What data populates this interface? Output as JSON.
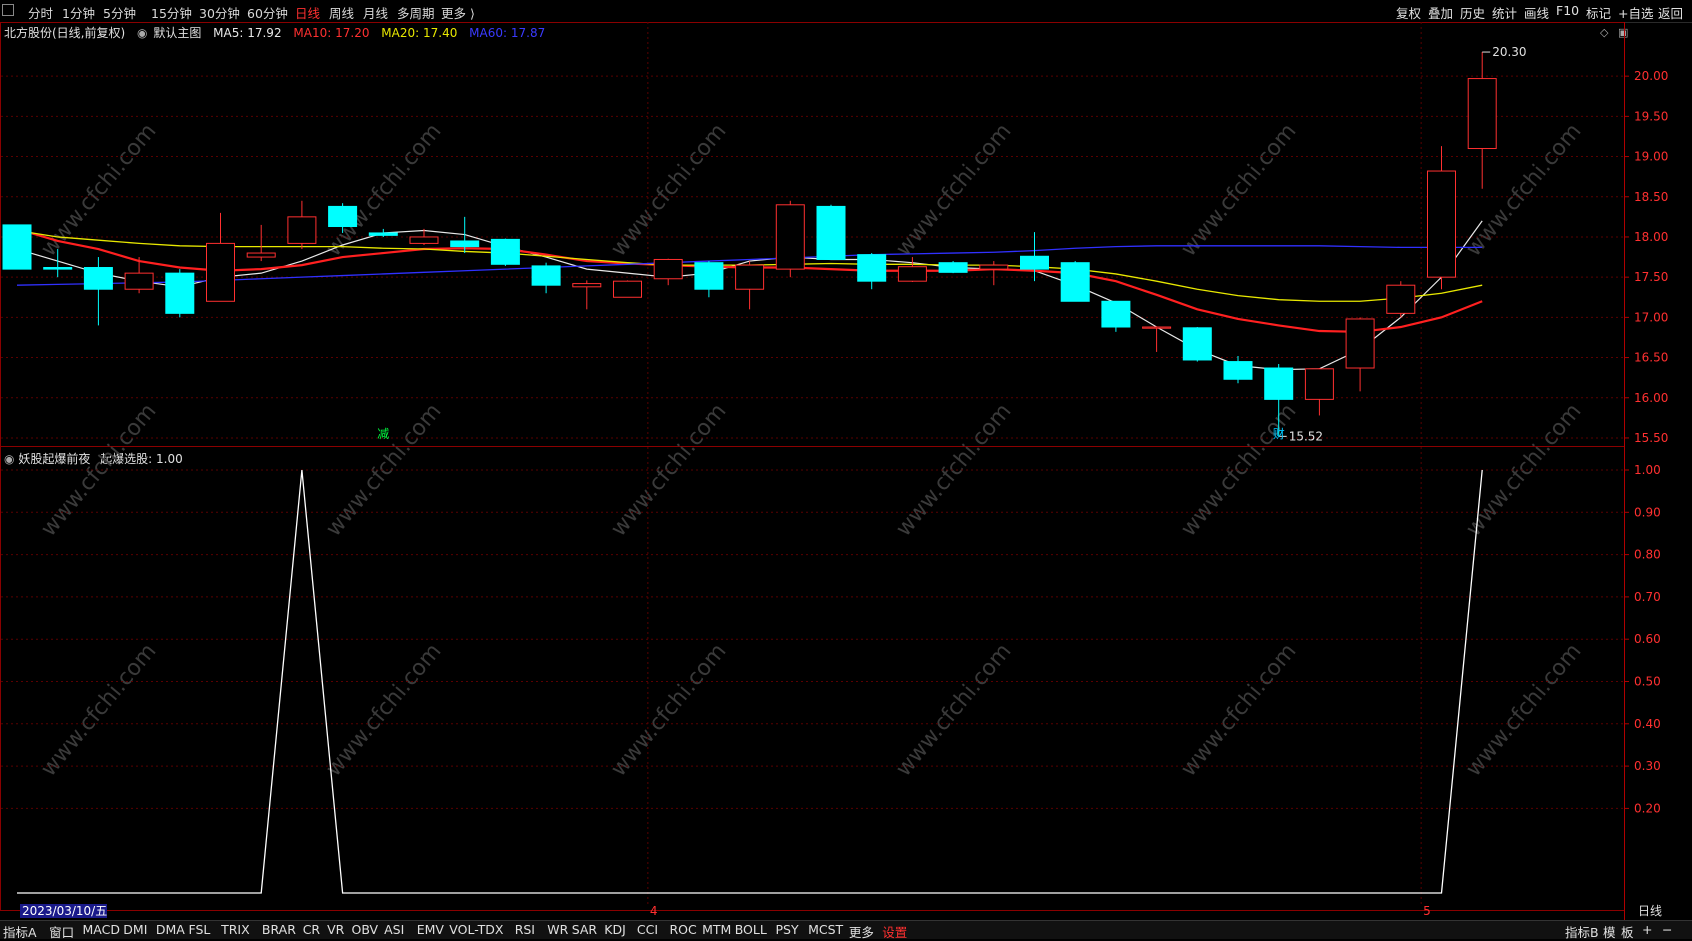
{
  "toolbar": {
    "periods": [
      "分时",
      "1分钟",
      "5分钟",
      "15分钟",
      "30分钟",
      "60分钟",
      "日线",
      "周线",
      "月线",
      "多周期",
      "更多 ⟩"
    ],
    "active_period": "日线",
    "right_items": [
      "复权",
      "叠加",
      "历史",
      "统计",
      "画线",
      "F10",
      "标记",
      "+自选",
      "返回"
    ]
  },
  "legend": {
    "stock": "北方股份(日线,前复权)",
    "template": "默认主图",
    "ma5": "MA5: 17.92",
    "ma10": "MA10: 17.20",
    "ma20": "MA20: 17.40",
    "ma60": "MA60: 17.87"
  },
  "colors": {
    "up": "#ff3030",
    "down": "#00ffff",
    "ma5": "#e8e8e8",
    "ma10": "#ff2020",
    "ma20": "#e8e800",
    "ma60": "#3030ff",
    "grid": "#5a0000",
    "indicator_line": "#ffffff"
  },
  "sub_legend": {
    "title": "妖股起爆前夜",
    "value": "起爆选股: 1.00"
  },
  "chart_data": [
    {
      "type": "candlestick",
      "title": "北方股份(日线,前复权)",
      "ylim": [
        15.4,
        20.4
      ],
      "y_ticks": [
        "20.00",
        "19.50",
        "19.00",
        "18.50",
        "18.00",
        "17.50",
        "17.00",
        "16.50",
        "16.00",
        "15.50"
      ],
      "y_tick_values": [
        20.0,
        19.5,
        19.0,
        18.5,
        18.0,
        17.5,
        17.0,
        16.5,
        16.0,
        15.5
      ],
      "candles": [
        {
          "o": 18.15,
          "h": 18.15,
          "l": 17.6,
          "c": 17.6
        },
        {
          "o": 17.62,
          "h": 17.85,
          "l": 17.5,
          "c": 17.6
        },
        {
          "o": 17.62,
          "h": 17.75,
          "l": 16.9,
          "c": 17.35
        },
        {
          "o": 17.35,
          "h": 17.75,
          "l": 17.3,
          "c": 17.55
        },
        {
          "o": 17.55,
          "h": 17.6,
          "l": 17.0,
          "c": 17.05
        },
        {
          "o": 17.2,
          "h": 18.3,
          "l": 17.2,
          "c": 17.92
        },
        {
          "o": 17.75,
          "h": 18.15,
          "l": 17.7,
          "c": 17.8
        },
        {
          "o": 17.92,
          "h": 18.45,
          "l": 17.85,
          "c": 18.25
        },
        {
          "o": 18.38,
          "h": 18.42,
          "l": 18.05,
          "c": 18.13
        },
        {
          "o": 18.05,
          "h": 18.1,
          "l": 18.0,
          "c": 18.02
        },
        {
          "o": 17.92,
          "h": 18.1,
          "l": 17.9,
          "c": 18.0
        },
        {
          "o": 17.95,
          "h": 18.25,
          "l": 17.8,
          "c": 17.88
        },
        {
          "o": 17.97,
          "h": 17.98,
          "l": 17.64,
          "c": 17.66
        },
        {
          "o": 17.64,
          "h": 17.68,
          "l": 17.3,
          "c": 17.4
        },
        {
          "o": 17.38,
          "h": 17.46,
          "l": 17.1,
          "c": 17.42
        },
        {
          "o": 17.25,
          "h": 17.46,
          "l": 17.25,
          "c": 17.45
        },
        {
          "o": 17.48,
          "h": 17.73,
          "l": 17.4,
          "c": 17.72
        },
        {
          "o": 17.68,
          "h": 17.7,
          "l": 17.25,
          "c": 17.35
        },
        {
          "o": 17.35,
          "h": 17.7,
          "l": 17.1,
          "c": 17.65
        },
        {
          "o": 17.6,
          "h": 18.45,
          "l": 17.5,
          "c": 18.4
        },
        {
          "o": 18.38,
          "h": 18.4,
          "l": 17.72,
          "c": 17.72
        },
        {
          "o": 17.78,
          "h": 17.8,
          "l": 17.35,
          "c": 17.45
        },
        {
          "o": 17.45,
          "h": 17.75,
          "l": 17.44,
          "c": 17.63
        },
        {
          "o": 17.68,
          "h": 17.7,
          "l": 17.55,
          "c": 17.56
        },
        {
          "o": 17.6,
          "h": 17.7,
          "l": 17.4,
          "c": 17.65
        },
        {
          "o": 17.76,
          "h": 18.06,
          "l": 17.45,
          "c": 17.6
        },
        {
          "o": 17.68,
          "h": 17.7,
          "l": 17.2,
          "c": 17.2
        },
        {
          "o": 17.2,
          "h": 17.2,
          "l": 16.82,
          "c": 16.88
        },
        {
          "o": 16.88,
          "h": 16.89,
          "l": 16.57,
          "c": 16.88
        },
        {
          "o": 16.87,
          "h": 16.88,
          "l": 16.45,
          "c": 16.47
        },
        {
          "o": 16.45,
          "h": 16.52,
          "l": 16.18,
          "c": 16.23
        },
        {
          "o": 16.37,
          "h": 16.42,
          "l": 15.52,
          "c": 15.98
        },
        {
          "o": 15.98,
          "h": 16.37,
          "l": 15.78,
          "c": 16.36
        },
        {
          "o": 16.37,
          "h": 17.0,
          "l": 16.08,
          "c": 16.98
        },
        {
          "o": 17.05,
          "h": 17.45,
          "l": 17.0,
          "c": 17.4
        },
        {
          "o": 17.5,
          "h": 19.13,
          "l": 17.35,
          "c": 18.82
        },
        {
          "o": 19.1,
          "h": 20.3,
          "l": 18.6,
          "c": 19.97
        }
      ],
      "annotations": [
        {
          "label": "20.30",
          "candle": 36,
          "price": 20.3
        },
        {
          "label": "15.52",
          "candle": 31,
          "price": 15.52
        },
        {
          "label": "减",
          "candle": 9
        },
        {
          "label": "财",
          "candle": 31
        }
      ],
      "series": [
        {
          "name": "MA5",
          "values": [
            17.85,
            17.7,
            17.55,
            17.45,
            17.38,
            17.5,
            17.55,
            17.7,
            17.9,
            18.05,
            18.08,
            18.03,
            17.88,
            17.75,
            17.6,
            17.55,
            17.5,
            17.55,
            17.7,
            17.75,
            17.72,
            17.72,
            17.68,
            17.62,
            17.6,
            17.58,
            17.4,
            17.18,
            16.88,
            16.6,
            16.4,
            16.35,
            16.36,
            16.6,
            17.0,
            17.5,
            18.2
          ]
        },
        {
          "name": "MA10",
          "values": [
            18.1,
            17.95,
            17.85,
            17.7,
            17.62,
            17.58,
            17.6,
            17.65,
            17.75,
            17.8,
            17.85,
            17.86,
            17.85,
            17.78,
            17.7,
            17.67,
            17.65,
            17.63,
            17.62,
            17.62,
            17.6,
            17.58,
            17.58,
            17.58,
            17.6,
            17.58,
            17.55,
            17.45,
            17.28,
            17.1,
            16.98,
            16.9,
            16.83,
            16.82,
            16.88,
            17.0,
            17.2
          ]
        },
        {
          "name": "MA20",
          "values": [
            18.08,
            18.0,
            17.96,
            17.92,
            17.89,
            17.88,
            17.88,
            17.88,
            17.88,
            17.86,
            17.85,
            17.82,
            17.8,
            17.76,
            17.72,
            17.68,
            17.65,
            17.65,
            17.65,
            17.66,
            17.67,
            17.66,
            17.66,
            17.65,
            17.65,
            17.63,
            17.6,
            17.54,
            17.45,
            17.35,
            17.27,
            17.22,
            17.2,
            17.2,
            17.24,
            17.3,
            17.4
          ]
        },
        {
          "name": "MA60",
          "values": [
            17.4,
            17.41,
            17.42,
            17.43,
            17.44,
            17.46,
            17.48,
            17.5,
            17.52,
            17.54,
            17.56,
            17.58,
            17.6,
            17.62,
            17.64,
            17.66,
            17.68,
            17.7,
            17.72,
            17.74,
            17.76,
            17.78,
            17.79,
            17.8,
            17.81,
            17.83,
            17.86,
            17.88,
            17.89,
            17.89,
            17.89,
            17.89,
            17.89,
            17.88,
            17.87,
            17.87,
            17.87
          ]
        }
      ]
    },
    {
      "type": "line",
      "title": "妖股起爆前夜",
      "ylim": [
        0,
        1.0
      ],
      "y_ticks": [
        "1.00",
        "0.90",
        "0.80",
        "0.70",
        "0.60",
        "0.50",
        "0.40",
        "0.30",
        "0.20"
      ],
      "y_tick_values": [
        1.0,
        0.9,
        0.8,
        0.7,
        0.6,
        0.5,
        0.4,
        0.3,
        0.2
      ],
      "series": [
        {
          "name": "起爆选股",
          "values": [
            0,
            0,
            0,
            0,
            0,
            0,
            0,
            1,
            0,
            0,
            0,
            0,
            0,
            0,
            0,
            0,
            0,
            0,
            0,
            0,
            0,
            0,
            0,
            0,
            0,
            0,
            0,
            0,
            0,
            0,
            0,
            0,
            0,
            0,
            0,
            0,
            1
          ]
        }
      ]
    }
  ],
  "x_axis": {
    "date_label": "2023/03/10/五",
    "month_labels": [
      {
        "label": "4",
        "candle": 16
      },
      {
        "label": "5",
        "candle": 35
      }
    ],
    "period_label": "日线"
  },
  "bottombar": {
    "items": [
      "指标A",
      "窗口",
      "MACD",
      "DMI",
      "DMA",
      "FSL",
      "TRIX",
      "BRAR",
      "CR",
      "VR",
      "OBV",
      "ASI",
      "EMV",
      "VOL-TDX",
      "RSI",
      "WR",
      "SAR",
      "KDJ",
      "CCI",
      "ROC",
      "MTM",
      "BOLL",
      "PSY",
      "MCST",
      "更多",
      "设置"
    ],
    "right_items": [
      "指标B",
      "模",
      "板",
      "+",
      "−"
    ]
  },
  "watermark": "www.cfchi.com"
}
